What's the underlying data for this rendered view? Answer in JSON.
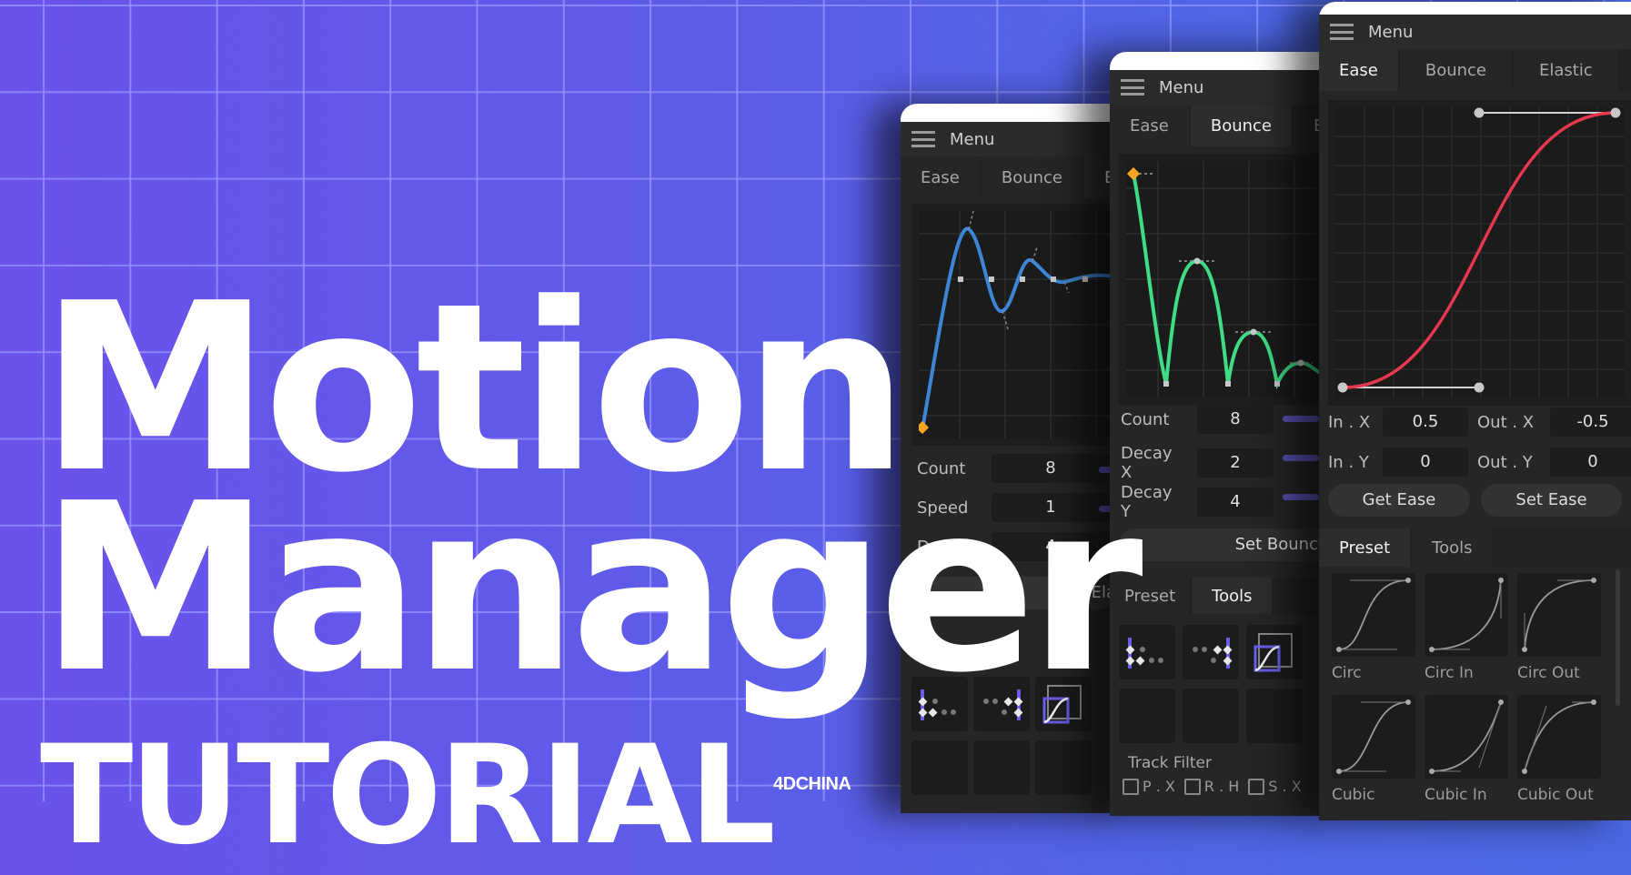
{
  "title": {
    "line1": "Motion",
    "line2": "Manager",
    "line3": "TUTORIAL",
    "watermark": "4DCHINA"
  },
  "colors": {
    "background_start": "#6a52ea",
    "background_end": "#4a6ae4",
    "elastic_curve": "#3d86d6",
    "bounce_curve": "#3fdc84",
    "ease_curve": "#e8384f",
    "key_diamond": "#f5a623",
    "accent_slider": "#5b53b8"
  },
  "panels": [
    {
      "id": "elastic-panel",
      "menu_label": "Menu",
      "tabs": [
        {
          "label": "Ease",
          "active": false
        },
        {
          "label": "Bounce",
          "active": false
        },
        {
          "label": "Ela",
          "active": true
        }
      ],
      "fields": [
        {
          "label": "Count",
          "value": "8"
        },
        {
          "label": "Speed",
          "value": "1"
        },
        {
          "label": "Decay",
          "value": "4"
        }
      ],
      "button_label": "Ela",
      "section_tab_hidden": "",
      "curve": "elastic"
    },
    {
      "id": "bounce-panel",
      "menu_label": "Menu",
      "tabs": [
        {
          "label": "Ease",
          "active": false
        },
        {
          "label": "Bounce",
          "active": true
        },
        {
          "label": "Ela",
          "active": false
        }
      ],
      "fields": [
        {
          "label": "Count",
          "value": "8"
        },
        {
          "label": "Decay X",
          "value": "2"
        },
        {
          "label": "Decay Y",
          "value": "4"
        }
      ],
      "button_label": "Set Bounce",
      "bottom_tabs": [
        {
          "label": "Preset",
          "active": false
        },
        {
          "label": "Tools",
          "active": true
        }
      ],
      "track_filter": {
        "label": "Track Filter",
        "options": [
          {
            "label": "P . X",
            "checked": false
          },
          {
            "label": "R . H",
            "checked": false
          },
          {
            "label": "S . X",
            "checked": false
          }
        ]
      },
      "curve": "bounce"
    },
    {
      "id": "ease-panel",
      "menu_label": "Menu",
      "tabs": [
        {
          "label": "Ease",
          "active": true
        },
        {
          "label": "Bounce",
          "active": false
        },
        {
          "label": "Elastic",
          "active": false
        }
      ],
      "fields": [
        {
          "label": "In . X",
          "value": "0.5"
        },
        {
          "label": "Out . X",
          "value": "-0.5"
        },
        {
          "label": "In . Y",
          "value": "0"
        },
        {
          "label": "Out . Y",
          "value": "0"
        }
      ],
      "buttons": {
        "get": "Get Ease",
        "set": "Set Ease"
      },
      "bottom_tabs": [
        {
          "label": "Preset",
          "active": true
        },
        {
          "label": "Tools",
          "active": false
        }
      ],
      "presets": [
        "Circ",
        "Circ In",
        "Circ Out",
        "Cubic",
        "Cubic In",
        "Cubic Out"
      ],
      "curve": "ease"
    }
  ]
}
